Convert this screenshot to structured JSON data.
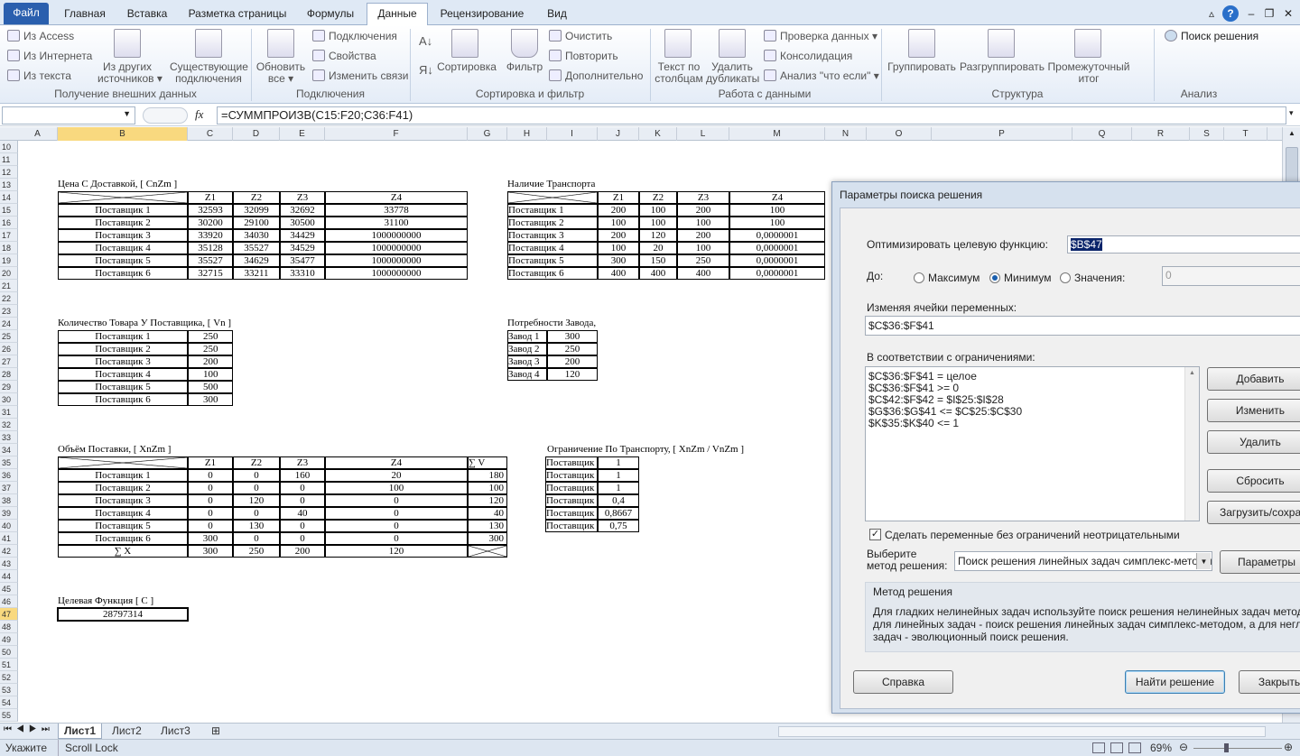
{
  "tabs": {
    "file": "Файл",
    "home": "Главная",
    "insert": "Вставка",
    "layout": "Разметка страницы",
    "formulas": "Формулы",
    "data": "Данные",
    "review": "Рецензирование",
    "view": "Вид"
  },
  "ribbon": {
    "from_access": "Из Access",
    "from_web": "Из Интернета",
    "from_text": "Из текста",
    "other_sources": "Из других",
    "other_sources2": "источников ▾",
    "existing": "Существующие",
    "existing2": "подключения",
    "refresh": "Обновить",
    "refresh2": "все ▾",
    "connections": "Подключения",
    "properties": "Свойства",
    "edit_links": "Изменить связи",
    "sort": "Сортировка",
    "filter": "Фильтр",
    "clear": "Очистить",
    "reapply": "Повторить",
    "advanced": "Дополнительно",
    "text_cols": "Текст по",
    "text_cols2": "столбцам",
    "remove_dup": "Удалить",
    "remove_dup2": "дубликаты",
    "validation": "Проверка данных ▾",
    "consolidate": "Консолидация",
    "whatif": "Анализ \"что если\" ▾",
    "group": "Группировать",
    "ungroup": "Разгруппировать",
    "subtotal": "Промежуточный",
    "subtotal2": "итог",
    "solver": "Поиск решения",
    "g1": "Получение внешних данных",
    "g2": "Подключения",
    "g3": "Сортировка и фильтр",
    "g4": "Работа с данными",
    "g5": "Структура",
    "g6": "Анализ"
  },
  "formula": {
    "fx": "fx",
    "text": "=СУММПРОИЗВ(C15:F20;C36:F41)"
  },
  "columns": [
    "A",
    "B",
    "C",
    "D",
    "E",
    "F",
    "G",
    "H",
    "I",
    "J",
    "K",
    "L",
    "M",
    "N",
    "O",
    "P",
    "Q",
    "R",
    "S",
    "T"
  ],
  "rows": [
    "10",
    "11",
    "12",
    "13",
    "14",
    "15",
    "16",
    "17",
    "18",
    "19",
    "20",
    "21",
    "22",
    "23",
    "24",
    "25",
    "26",
    "27",
    "28",
    "29",
    "30",
    "31",
    "32",
    "33",
    "34",
    "35",
    "36",
    "37",
    "38",
    "39",
    "40",
    "41",
    "42",
    "43",
    "44",
    "45",
    "46",
    "47",
    "48",
    "49",
    "50",
    "51",
    "52",
    "53",
    "54",
    "55"
  ],
  "sheet": {
    "t1_title": "Цена С Доставкой, [ CnZm ]",
    "zhdr": [
      "Z1",
      "Z2",
      "Z3",
      "Z4"
    ],
    "suppliers": [
      "Поставщик 1",
      "Поставщик 2",
      "Поставщик 3",
      "Поставщик 4",
      "Поставщик 5",
      "Поставщик 6"
    ],
    "t1_vals": [
      [
        "32593",
        "32099",
        "32692",
        "33778"
      ],
      [
        "30200",
        "29100",
        "30500",
        "31100"
      ],
      [
        "33920",
        "34030",
        "34429",
        "1000000000"
      ],
      [
        "35128",
        "35527",
        "34529",
        "1000000000"
      ],
      [
        "35527",
        "34629",
        "35477",
        "1000000000"
      ],
      [
        "32715",
        "33211",
        "33310",
        "1000000000"
      ]
    ],
    "t2_title": "Наличие Транспорта Для Доставки, [ VnZm ]",
    "t2_vals": [
      [
        "200",
        "100",
        "200",
        "100"
      ],
      [
        "100",
        "100",
        "100",
        "100"
      ],
      [
        "200",
        "120",
        "200",
        "0,0000001"
      ],
      [
        "100",
        "20",
        "100",
        "0,0000001"
      ],
      [
        "300",
        "150",
        "250",
        "0,0000001"
      ],
      [
        "400",
        "400",
        "400",
        "0,0000001"
      ]
    ],
    "t3_title": "Количество Товара У Поставщика, [ Vn ]",
    "t3_vals": [
      "250",
      "250",
      "200",
      "100",
      "500",
      "300"
    ],
    "t4_title": "Потребности Завода, [ Dn ]",
    "plants": [
      "Завод 1",
      "Завод 2",
      "Завод 3",
      "Завод 4"
    ],
    "t4_vals": [
      "300",
      "250",
      "200",
      "120"
    ],
    "t5_title": "Объём Поставки, [ XnZm ]",
    "t5_sumv": "∑ V",
    "t5_vals": [
      [
        "0",
        "0",
        "160",
        "20",
        "180"
      ],
      [
        "0",
        "0",
        "0",
        "100",
        "100"
      ],
      [
        "0",
        "120",
        "0",
        "0",
        "120"
      ],
      [
        "0",
        "0",
        "40",
        "0",
        "40"
      ],
      [
        "0",
        "130",
        "0",
        "0",
        "130"
      ],
      [
        "300",
        "0",
        "0",
        "0",
        "300"
      ]
    ],
    "t5_sumx": "∑ X",
    "t5_totals": [
      "300",
      "250",
      "200",
      "120"
    ],
    "t6_title": "Ограничение По Транспорту, [ XnZm / VnZm ]",
    "t6_vals": [
      "1",
      "1",
      "1",
      "0,4",
      "0,8667",
      "0,75"
    ],
    "t7_title": "Целевая Функция [ C ]",
    "t7_val": "28797314"
  },
  "sheet_tabs": [
    "Лист1",
    "Лист2",
    "Лист3"
  ],
  "status": {
    "mode": "Укажите",
    "scroll": "Scroll Lock",
    "zoom": "69%"
  },
  "dialog": {
    "title": "Параметры поиска решения",
    "objective_label": "Оптимизировать целевую функцию:",
    "objective": "$B$47",
    "to": "До:",
    "max": "Максимум",
    "min": "Минимум",
    "value": "Значения:",
    "value_field": "0",
    "vars_label": "Изменяя ячейки переменных:",
    "vars": "$C$36:$F$41",
    "constraints_label": "В соответствии с ограничениями:",
    "constraints": [
      "$C$36:$F$41 = целое",
      "$C$36:$F$41 >= 0",
      "$C$42:$F$42 = $I$25:$I$28",
      "$G$36:$G$41 <= $C$25:$C$30",
      "$K$35:$K$40 <= 1"
    ],
    "add": "Добавить",
    "change": "Изменить",
    "delete": "Удалить",
    "reset": "Сбросить",
    "load": "Загрузить/сохран",
    "nonneg": "Сделать переменные без ограничений неотрицательными",
    "method_label1": "Выберите",
    "method_label2": "метод решения:",
    "method": "Поиск решения линейных задач симплекс-методом",
    "params": "Параметры",
    "method_title": "Метод решения",
    "method_desc1": "Для гладких нелинейных задач используйте поиск решения нелинейных задач методом ОПГ",
    "method_desc2": "для линейных задач - поиск решения линейных задач симплекс-методом, а для негладких",
    "method_desc3": "задач - эволюционный поиск решения.",
    "help": "Справка",
    "solve": "Найти решение",
    "close": "Закрыть"
  },
  "colors": {
    "accent": "#2a5fae",
    "selected_header": "#f9d97f",
    "dialog_bg": "#f0f0f0"
  }
}
